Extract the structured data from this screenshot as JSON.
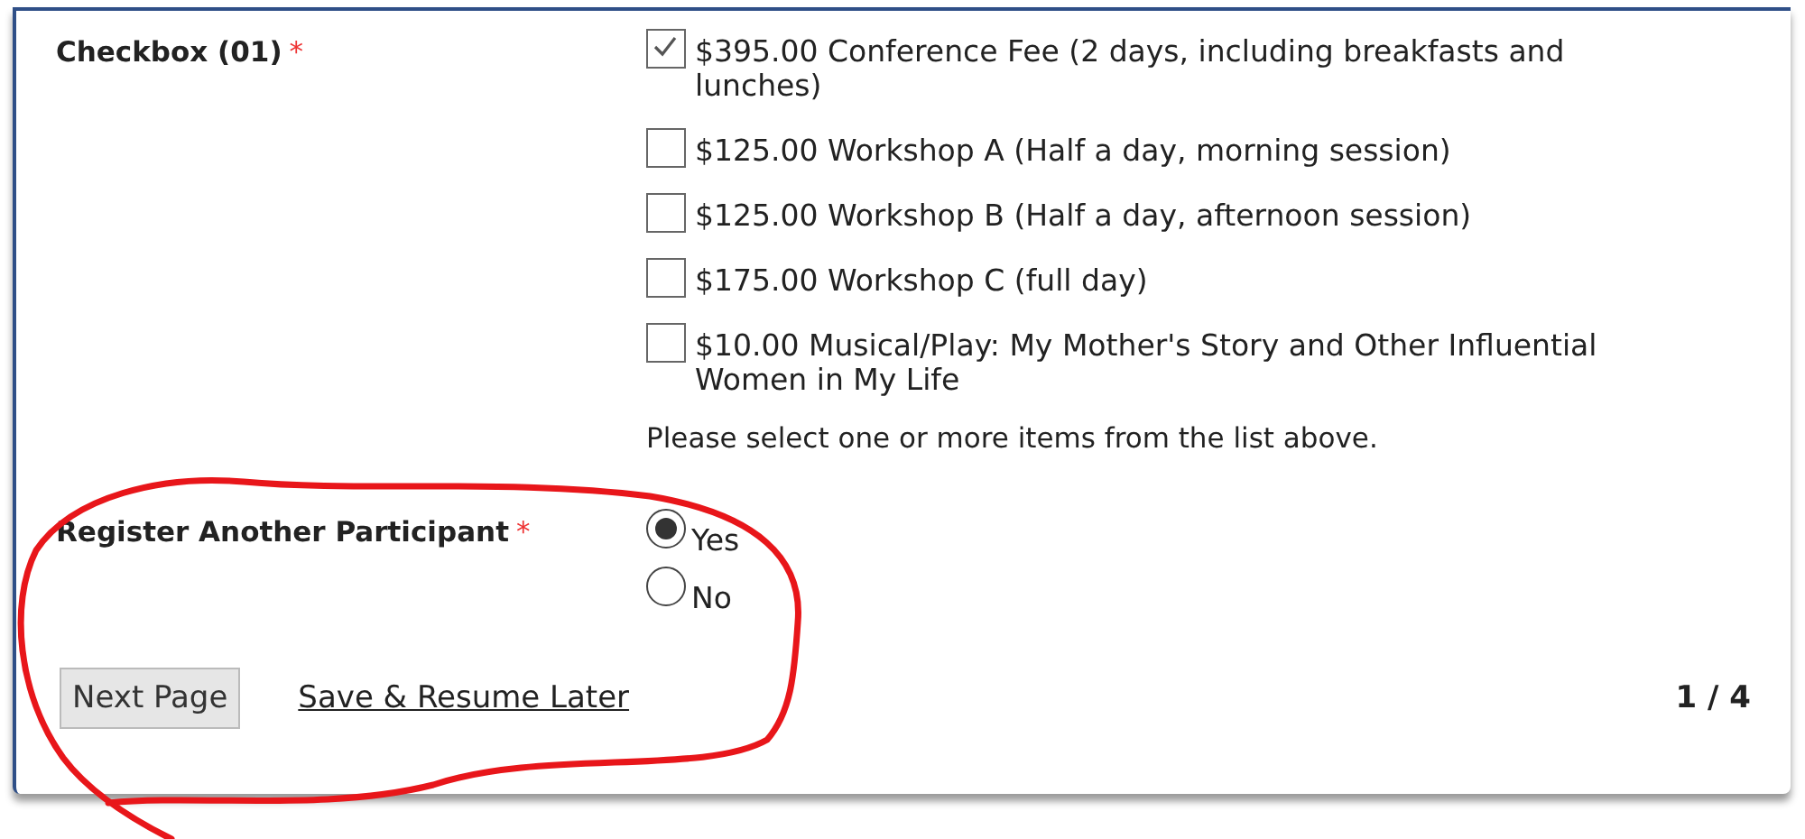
{
  "fields": [
    {
      "label": "Checkbox (01)",
      "required": "*",
      "kind": "checkbox",
      "options": [
        {
          "label": "$395.00 Conference Fee (2 days, including breakfasts and lunches)",
          "checked": true
        },
        {
          "label": "$125.00 Workshop A (Half a day, morning session)",
          "checked": false
        },
        {
          "label": "$125.00 Workshop B (Half a day, afternoon session)",
          "checked": false
        },
        {
          "label": "$175.00 Workshop C (full day)",
          "checked": false
        },
        {
          "label": "$10.00 Musical/Play: My Mother's Story and Other Influential Women in My Life",
          "checked": false
        }
      ],
      "help": "Please select one or more items from the list above."
    },
    {
      "label": "Register Another Participant",
      "required": "*",
      "kind": "radio",
      "options": [
        {
          "label": "Yes",
          "selected": true
        },
        {
          "label": "No",
          "selected": false
        }
      ]
    }
  ],
  "buttons": {
    "next": "Next Page",
    "save_link": "Save & Resume Later"
  },
  "page_indicator": "1 / 4"
}
